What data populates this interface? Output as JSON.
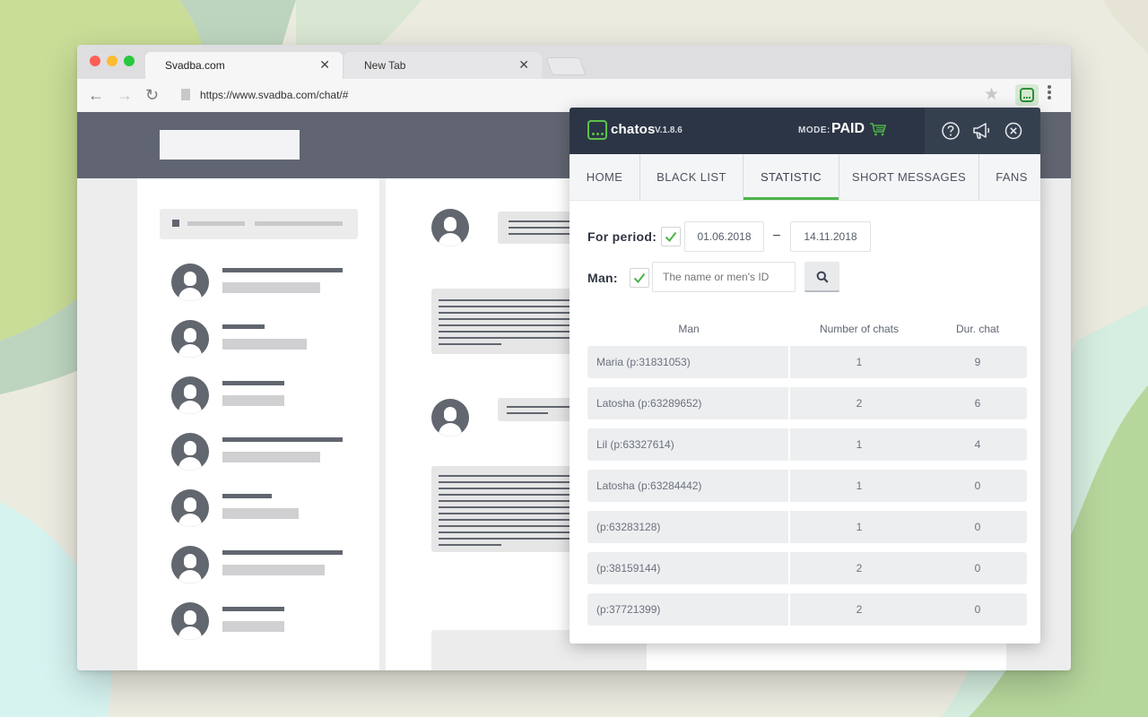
{
  "browser": {
    "tabs": [
      {
        "label": "Svadba.com",
        "close": "✕"
      },
      {
        "label": "New Tab",
        "close": "✕"
      }
    ],
    "url": "https://www.svadba.com/chat/#",
    "nav": {
      "back": "←",
      "forward": "→",
      "reload": "↻"
    },
    "star": "★"
  },
  "popup": {
    "brand": "chatos",
    "version": "V.1.8.6",
    "mode_label": "MODE:",
    "mode_value": "PAID",
    "tabs": [
      "HOME",
      "BLACK LIST",
      "STATISTIC",
      "SHORT MESSAGES",
      "FANS"
    ],
    "active_tab": "STATISTIC",
    "period_label": "For period:",
    "date_from": "01.06.2018",
    "date_sep": "–",
    "date_to": "14.11.2018",
    "man_label": "Man:",
    "man_placeholder": "The name or men's ID",
    "columns": [
      "Man",
      "Number of chats",
      "Dur. chat"
    ],
    "rows": [
      {
        "man": "Maria (p:31831053)",
        "chats": "1",
        "dur": "9"
      },
      {
        "man": "Latosha (p:63289652)",
        "chats": "2",
        "dur": "6"
      },
      {
        "man": "Lil (p:63327614)",
        "chats": "1",
        "dur": "4"
      },
      {
        "man": "Latosha (p:63284442)",
        "chats": "1",
        "dur": "0"
      },
      {
        "man": "(p:63283128)",
        "chats": "1",
        "dur": "0"
      },
      {
        "man": "(p:38159144)",
        "chats": "2",
        "dur": "0"
      },
      {
        "man": "(p:37721399)",
        "chats": "2",
        "dur": "0"
      }
    ],
    "accent": "#4cb34a",
    "header_bg": "#2c3545"
  }
}
